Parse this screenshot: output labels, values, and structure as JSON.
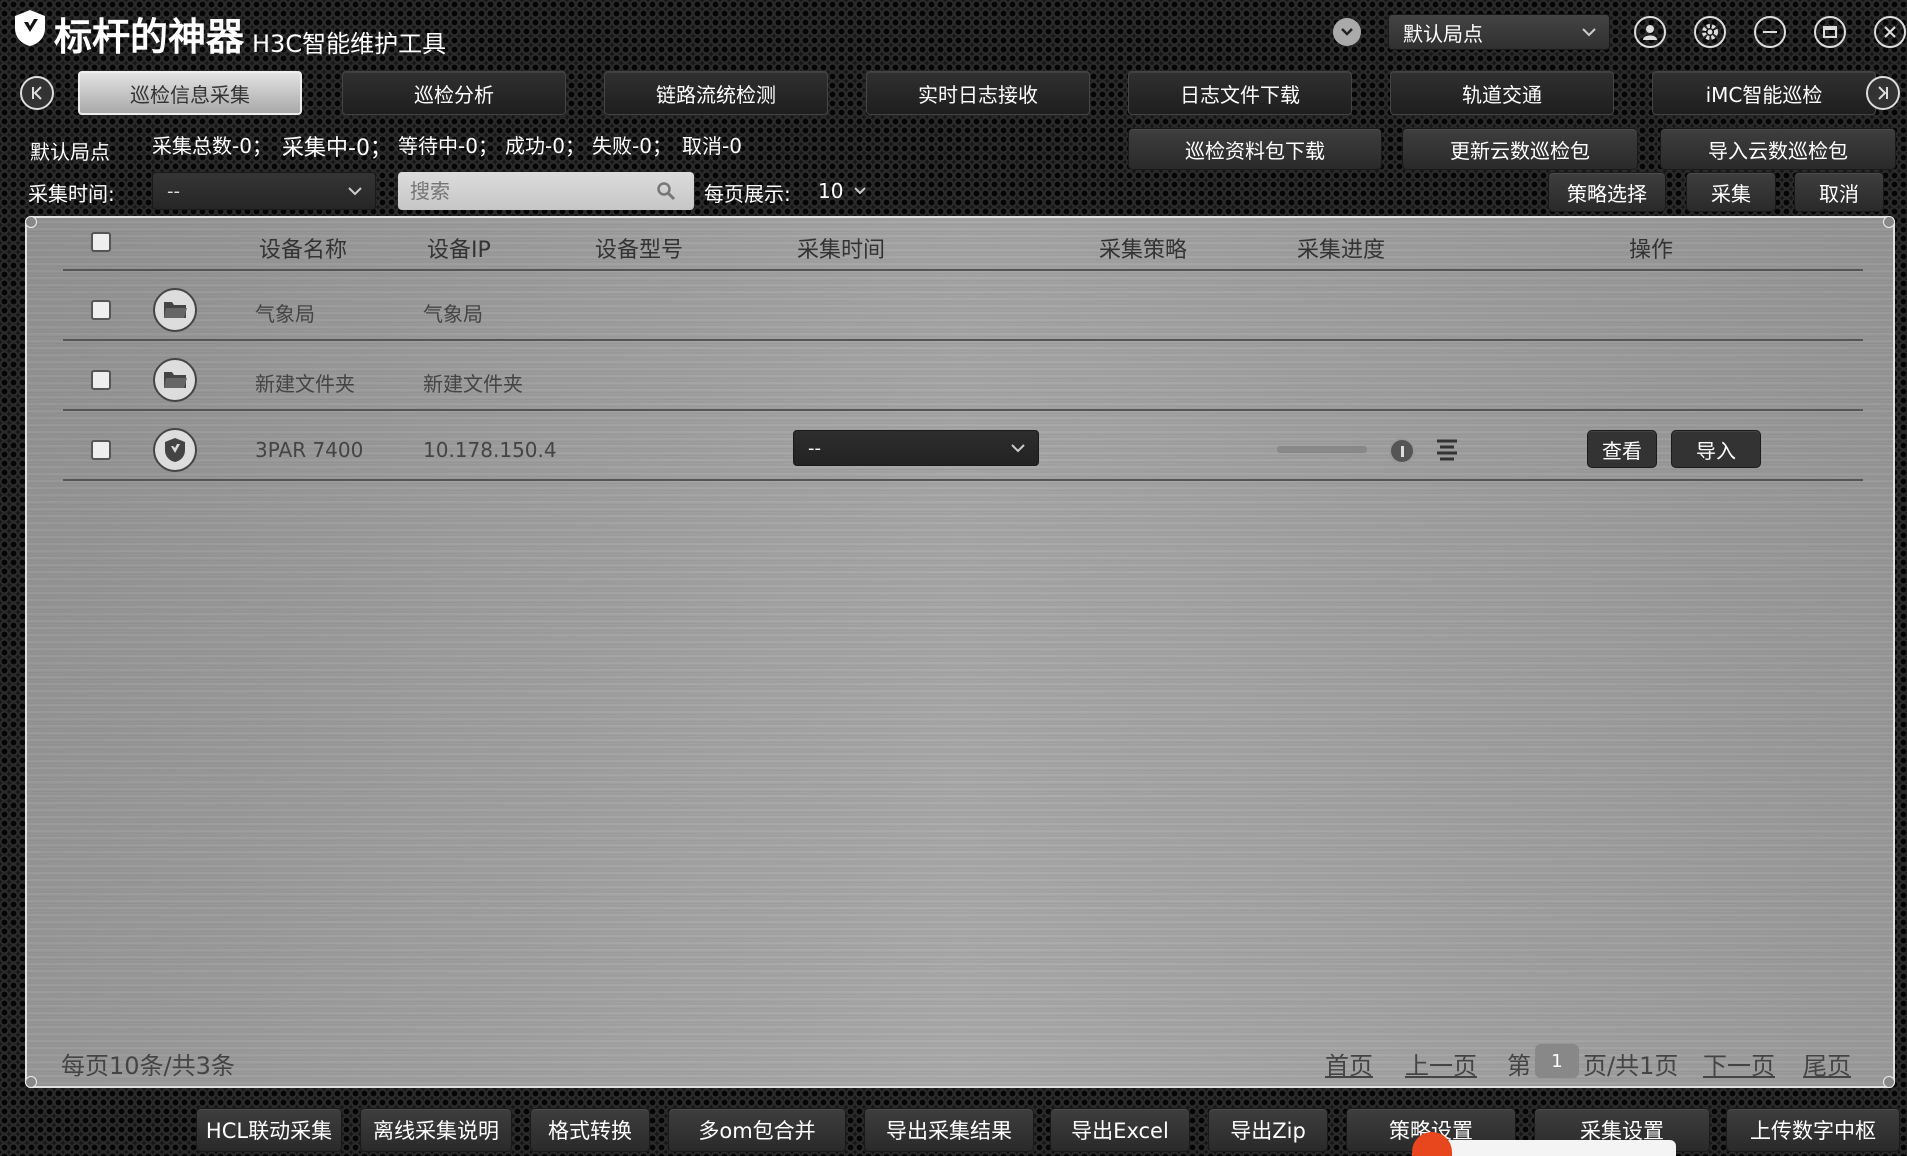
{
  "app": {
    "title": "标杆的神器",
    "subtitle": "H3C智能维护工具",
    "site_selector": "默认局点"
  },
  "tabs": [
    {
      "label": "巡检信息采集",
      "active": true
    },
    {
      "label": "巡检分析"
    },
    {
      "label": "链路流统检测"
    },
    {
      "label": "实时日志接收"
    },
    {
      "label": "日志文件下载"
    },
    {
      "label": "轨道交通"
    },
    {
      "label": "iMC智能巡检"
    }
  ],
  "status": {
    "site": "默认局点",
    "total": "采集总数-0；",
    "collecting": "采集中-0；",
    "waiting": "等待中-0；",
    "success": "成功-0；",
    "failed": "失败-0；",
    "cancelled": "取消-0"
  },
  "actions": {
    "download_pkg": "巡检资料包下载",
    "update_cloud": "更新云数巡检包",
    "import_cloud": "导入云数巡检包",
    "strategy_select": "策略选择",
    "collect": "采集",
    "cancel": "取消"
  },
  "filters": {
    "time_label": "采集时间:",
    "time_value": "--",
    "search_placeholder": "搜索",
    "per_page_label": "每页展示:",
    "per_page_value": "10"
  },
  "table": {
    "headers": [
      "设备名称",
      "设备IP",
      "设备型号",
      "采集时间",
      "采集策略",
      "采集进度",
      "操作"
    ],
    "rows": [
      {
        "type": "folder",
        "name": "气象局",
        "ip": "气象局"
      },
      {
        "type": "folder",
        "name": "新建文件夹",
        "ip": "新建文件夹"
      },
      {
        "type": "device",
        "name": "3PAR 7400",
        "ip": "10.178.150.4",
        "strategy": "--",
        "progress": 0,
        "view": "查看",
        "import": "导入"
      }
    ]
  },
  "pagination": {
    "summary": "每页10条/共3条",
    "first": "首页",
    "prev": "上一页",
    "page_prefix": "第",
    "current": "1",
    "page_suffix": "页/共1页",
    "next": "下一页",
    "last": "尾页"
  },
  "bottom_bar": [
    "HCL联动采集",
    "离线采集说明",
    "格式转换",
    "多om包合并",
    "导出采集结果",
    "导出Excel",
    "导出Zip",
    "策略设置",
    "采集设置",
    "上传数字中枢"
  ],
  "colors": {
    "panel": "#c4c4c4",
    "button": "#333333",
    "active_tab": "#c8c8c8",
    "ime_logo": "#e8471d"
  }
}
